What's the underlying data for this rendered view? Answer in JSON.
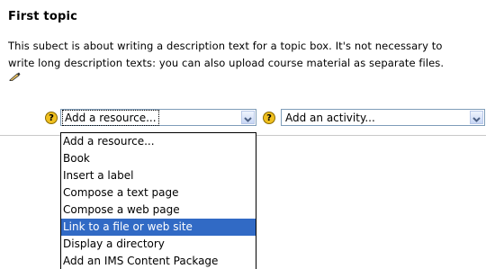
{
  "section": {
    "heading": "First topic",
    "description_line1": "This subect is about writing a description text for a topic box. It's not necessary to",
    "description_line2": "write long description texts: you can also upload course material as separate files."
  },
  "icons": {
    "edit": "pencil-edit-icon",
    "help": "question-mark-help-icon",
    "help_glyph": "?",
    "dropdown": "chevron-down-icon"
  },
  "resource_select": {
    "value": "Add a resource...",
    "options": [
      "Add a resource...",
      "Book",
      "Insert a label",
      "Compose a text page",
      "Compose a web page",
      "Link to a file or web site",
      "Display a directory",
      "Add an IMS Content Package"
    ],
    "highlighted": "Link to a file or web site"
  },
  "activity_select": {
    "value": "Add an activity..."
  },
  "colors": {
    "selection": "#316ac5",
    "help_icon": "#f0c020",
    "border": "#7f9db9"
  }
}
